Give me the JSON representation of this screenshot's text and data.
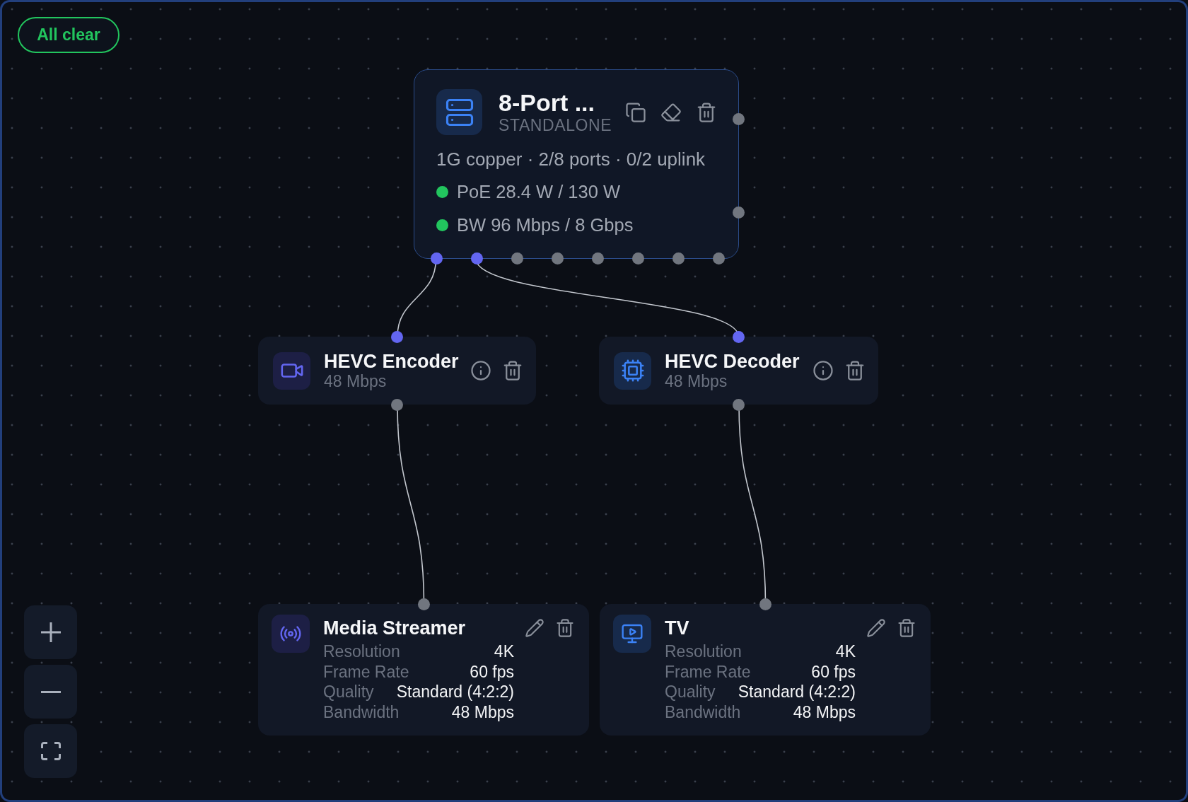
{
  "status_badge": {
    "label": "All clear",
    "healthy": true
  },
  "nodes": [
    {
      "kind": "switch",
      "title": "8-Port ...",
      "subtitle": "STANDALONE",
      "summary": "1G copper · 2/8 ports · 0/2 uplink",
      "meters": [
        {
          "label": "PoE 28.4 W / 130 W",
          "color": "#22c55e"
        },
        {
          "label": "BW 96 Mbps / 8 Gbps",
          "color": "#22c55e"
        }
      ],
      "uplink_ports": [
        {
          "active": false
        },
        {
          "active": false
        }
      ],
      "ports": [
        {
          "active": true
        },
        {
          "active": true
        },
        {
          "active": false
        },
        {
          "active": false
        },
        {
          "active": false
        },
        {
          "active": false
        },
        {
          "active": false
        },
        {
          "active": false
        }
      ]
    },
    {
      "kind": "encoder",
      "title": "HEVC Encoder",
      "subtitle": "48 Mbps",
      "input_port": {
        "active": true
      },
      "output_port": {
        "active": false
      }
    },
    {
      "kind": "decoder",
      "title": "HEVC Decoder",
      "subtitle": "48 Mbps",
      "input_port": {
        "active": true
      },
      "output_port": {
        "active": false
      }
    },
    {
      "kind": "streamer",
      "title": "Media Streamer",
      "input_port": {
        "active": false
      },
      "specs": [
        {
          "label": "Resolution",
          "value": "4K"
        },
        {
          "label": "Frame Rate",
          "value": "60 fps"
        },
        {
          "label": "Quality",
          "value": "Standard (4:2:2)"
        },
        {
          "label": "Bandwidth",
          "value": "48 Mbps"
        }
      ]
    },
    {
      "kind": "display",
      "title": "TV",
      "input_port": {
        "active": false
      },
      "specs": [
        {
          "label": "Resolution",
          "value": "4K"
        },
        {
          "label": "Frame Rate",
          "value": "60 fps"
        },
        {
          "label": "Quality",
          "value": "Standard (4:2:2)"
        },
        {
          "label": "Bandwidth",
          "value": "48 Mbps"
        }
      ]
    }
  ]
}
